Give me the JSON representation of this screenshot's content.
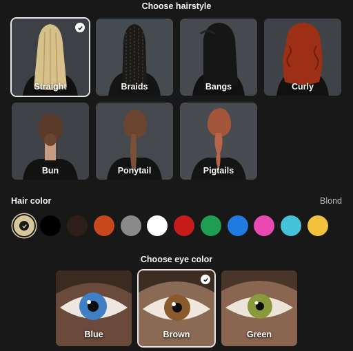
{
  "hairstyle_section": {
    "title": "Choose hairstyle",
    "selected": "Straight",
    "options": [
      {
        "label": "Straight",
        "hair_color": "#d8c08a",
        "icon": "straight-hair-icon"
      },
      {
        "label": "Braids",
        "hair_color": "#1c1a18",
        "icon": "braids-hair-icon"
      },
      {
        "label": "Bangs",
        "hair_color": "#161616",
        "icon": "bangs-hair-icon"
      },
      {
        "label": "Curly",
        "hair_color": "#9c2f16",
        "icon": "curly-hair-icon"
      },
      {
        "label": "Bun",
        "hair_color": "#5a3a28",
        "icon": "bun-hair-icon"
      },
      {
        "label": "Ponytail",
        "hair_color": "#6b4530",
        "icon": "ponytail-hair-icon"
      },
      {
        "label": "Pigtails",
        "hair_color": "#a3563a",
        "icon": "pigtails-hair-icon"
      }
    ]
  },
  "hair_color_section": {
    "label": "Hair color",
    "selected_value": "Blond",
    "swatches": [
      "#d8c79a",
      "#000000",
      "#2e1f1a",
      "#c8481e",
      "#8a8a8a",
      "#ffffff",
      "#c61b1b",
      "#1f9d52",
      "#1f7be0",
      "#e84ab2",
      "#44c3d6",
      "#f3c23c"
    ]
  },
  "eye_section": {
    "title": "Choose eye color",
    "selected": "Brown",
    "options": [
      {
        "label": "Blue",
        "iris_color": "#3f7fc4",
        "icon": "blue-eye-icon"
      },
      {
        "label": "Brown",
        "iris_color": "#8a5a2c",
        "icon": "brown-eye-icon"
      },
      {
        "label": "Green",
        "iris_color": "#8a9a3a",
        "icon": "green-eye-icon"
      }
    ]
  }
}
